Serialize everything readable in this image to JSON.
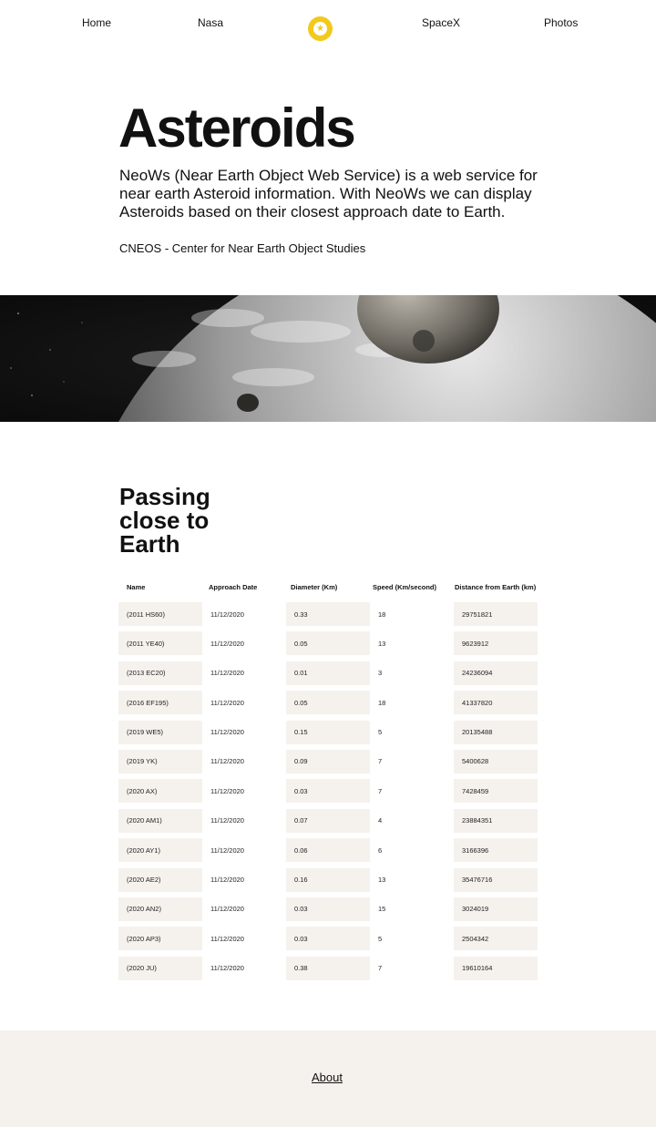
{
  "nav": {
    "home": "Home",
    "nasa": "Nasa",
    "logo_icon": "star-icon",
    "spacex": "SpaceX",
    "photos": "Photos"
  },
  "hero": {
    "title": "Asteroids",
    "intro": "NeoWs (Near Earth Object Web Service) is a web service for near earth Asteroid information. With NeoWs we can display Asteroids based on their closest approach date to Earth.",
    "source": "CNEOS - Center for Near Earth Object Studies"
  },
  "section": {
    "title": "Passing close to Earth"
  },
  "table": {
    "headers": [
      "Name",
      "Approach Date",
      "Diameter (Km)",
      "Speed (Km/second)",
      "Distance from Earth (km)"
    ],
    "rows": [
      [
        "(2011 HS60)",
        "11/12/2020",
        "0.33",
        "18",
        "29751821"
      ],
      [
        "(2011 YE40)",
        "11/12/2020",
        "0.05",
        "13",
        "9623912"
      ],
      [
        "(2013 EC20)",
        "11/12/2020",
        "0.01",
        "3",
        "24236094"
      ],
      [
        "(2016 EF195)",
        "11/12/2020",
        "0.05",
        "18",
        "41337820"
      ],
      [
        "(2019 WE5)",
        "11/12/2020",
        "0.15",
        "5",
        "20135488"
      ],
      [
        "(2019 YK)",
        "11/12/2020",
        "0.09",
        "7",
        "5400628"
      ],
      [
        "(2020 AX)",
        "11/12/2020",
        "0.03",
        "7",
        "7428459"
      ],
      [
        "(2020 AM1)",
        "11/12/2020",
        "0.07",
        "4",
        "23884351"
      ],
      [
        "(2020 AY1)",
        "11/12/2020",
        "0.06",
        "6",
        "3166396"
      ],
      [
        "(2020 AE2)",
        "11/12/2020",
        "0.16",
        "13",
        "35476716"
      ],
      [
        "(2020 AN2)",
        "11/12/2020",
        "0.03",
        "15",
        "3024019"
      ],
      [
        "(2020 AP3)",
        "11/12/2020",
        "0.03",
        "5",
        "2504342"
      ],
      [
        "(2020 JU)",
        "11/12/2020",
        "0.38",
        "7",
        "19610164"
      ]
    ]
  },
  "footer": {
    "about": "About"
  },
  "colors": {
    "accent": "#f2c91c",
    "cell_bg": "#f5f2ed",
    "footer_bg": "#f5f2ed"
  }
}
